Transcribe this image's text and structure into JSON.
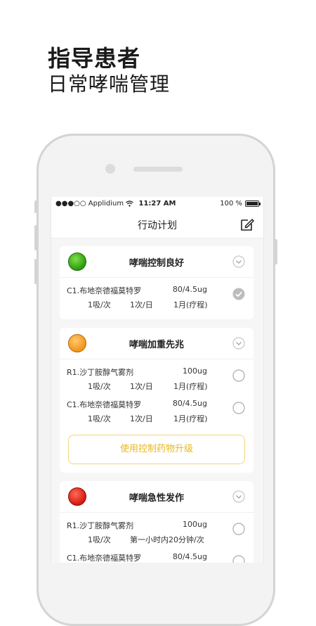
{
  "headline": {
    "line1": "指导患者",
    "line2": "日常哮喘管理"
  },
  "statusbar": {
    "carrier": "●●●○○ Applidium",
    "time": "11:27 AM",
    "battery": "100 %"
  },
  "nav": {
    "title": "行动计划",
    "icon": "edit-icon"
  },
  "colors": {
    "accent_yellow": "#e7b81e",
    "green": "#2c9a0e",
    "orange": "#f0951a",
    "red": "#d41a10"
  },
  "cards": [
    {
      "title": "哮喘控制良好",
      "light": "green",
      "meds": [
        {
          "name": "C1.布地奈德福莫特罗",
          "dose": "80/4.5ug",
          "amount": "1吸/次",
          "frequency": "1次/日",
          "duration": "1月(疗程)",
          "checked": true
        }
      ]
    },
    {
      "title": "哮喘加重先兆",
      "light": "orange",
      "meds": [
        {
          "name": "R1.沙丁胺醇气雾剂",
          "dose": "100ug",
          "amount": "1吸/次",
          "frequency": "1次/日",
          "duration": "1月(疗程)",
          "checked": false
        },
        {
          "name": "C1.布地奈德福莫特罗",
          "dose": "80/4.5ug",
          "amount": "1吸/次",
          "frequency": "1次/日",
          "duration": "1月(疗程)",
          "checked": false
        }
      ],
      "button": "使用控制药物升级"
    },
    {
      "title": "哮喘急性发作",
      "light": "red",
      "meds": [
        {
          "name": "R1.沙丁胺醇气雾剂",
          "dose": "100ug",
          "amount": "1吸/次",
          "frequency": "第一小时内20分钟/次",
          "duration": "",
          "checked": false
        },
        {
          "name": "C1.布地奈德福莫特罗",
          "dose": "80/4.5ug",
          "amount": "",
          "frequency": "",
          "duration": "",
          "checked": false
        }
      ]
    }
  ]
}
